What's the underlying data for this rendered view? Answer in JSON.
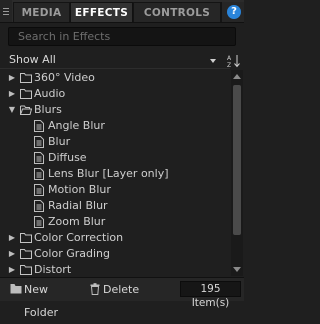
{
  "tabs": [
    {
      "label": "MEDIA",
      "active": false
    },
    {
      "label": "EFFECTS",
      "active": true
    },
    {
      "label": "CONTROLS",
      "active": false
    }
  ],
  "help": {
    "label": "?"
  },
  "search": {
    "placeholder": "Search in Effects"
  },
  "filter": {
    "selected": "Show All"
  },
  "tree": [
    {
      "type": "folder",
      "label": "360° Video",
      "level": 0,
      "expanded": false
    },
    {
      "type": "folder",
      "label": "Audio",
      "level": 0,
      "expanded": false
    },
    {
      "type": "folder",
      "label": "Blurs",
      "level": 0,
      "expanded": true
    },
    {
      "type": "effect",
      "label": "Angle Blur",
      "level": 1
    },
    {
      "type": "effect",
      "label": "Blur",
      "level": 1
    },
    {
      "type": "effect",
      "label": "Diffuse",
      "level": 1
    },
    {
      "type": "effect",
      "label": "Lens Blur [Layer only]",
      "level": 1
    },
    {
      "type": "effect",
      "label": "Motion Blur",
      "level": 1
    },
    {
      "type": "effect",
      "label": "Radial Blur",
      "level": 1
    },
    {
      "type": "effect",
      "label": "Zoom Blur",
      "level": 1
    },
    {
      "type": "folder",
      "label": "Color Correction",
      "level": 0,
      "expanded": false
    },
    {
      "type": "folder",
      "label": "Color Grading",
      "level": 0,
      "expanded": false
    },
    {
      "type": "folder",
      "label": "Distort",
      "level": 0,
      "expanded": false
    }
  ],
  "footer": {
    "new_folder": "New Folder",
    "delete": "Delete",
    "item_count": "195 Item(s)"
  },
  "colors": {
    "accent": "#2a84d9",
    "background": "#1f1f1f"
  }
}
